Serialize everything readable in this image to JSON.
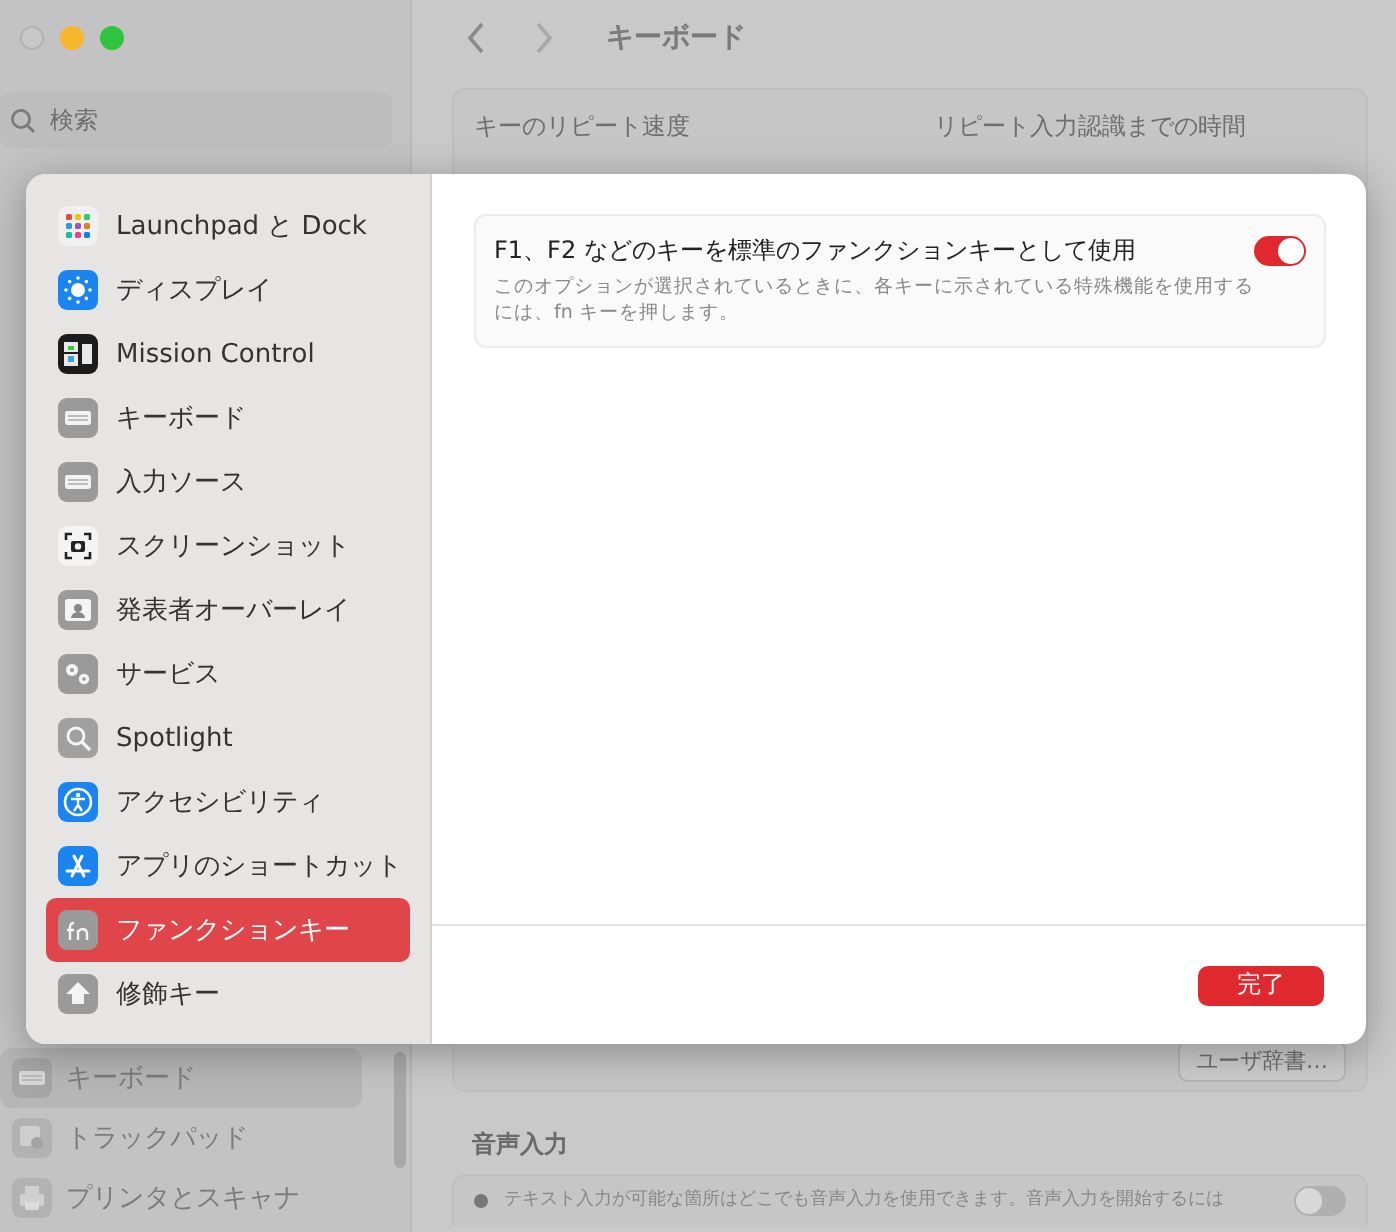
{
  "background_window": {
    "search": {
      "placeholder": "検索"
    },
    "title": "キーボード",
    "section_labels": [
      "キーのリピート速度",
      "リピート入力認識までの時間"
    ],
    "user_dictionary_button": "ユーザ辞書…",
    "sidebar_items": [
      {
        "label": "キーボード",
        "kind": "keyboard",
        "selected": true
      },
      {
        "label": "トラックパッド",
        "kind": "trackpad",
        "selected": false
      },
      {
        "label": "プリンタとスキャナ",
        "kind": "printer",
        "selected": false
      }
    ],
    "dictation": {
      "heading": "音声入力",
      "description": "テキスト入力が可能な箇所はどこでも音声入力を使用できます。音声入力を開始するには",
      "on": false
    }
  },
  "dialog": {
    "sidebar_items": [
      {
        "label": "Launchpad と Dock",
        "kind": "launchpad",
        "selected": false
      },
      {
        "label": "ディスプレイ",
        "kind": "display",
        "selected": false
      },
      {
        "label": "Mission Control",
        "kind": "mission",
        "selected": false
      },
      {
        "label": "キーボード",
        "kind": "keyboard",
        "selected": false
      },
      {
        "label": "入力ソース",
        "kind": "keyboard",
        "selected": false
      },
      {
        "label": "スクリーンショット",
        "kind": "screenshot",
        "selected": false
      },
      {
        "label": "発表者オーバーレイ",
        "kind": "presenter",
        "selected": false
      },
      {
        "label": "サービス",
        "kind": "gears",
        "selected": false
      },
      {
        "label": "Spotlight",
        "kind": "search",
        "selected": false
      },
      {
        "label": "アクセシビリティ",
        "kind": "accessibility",
        "selected": false
      },
      {
        "label": "アプリのショートカット",
        "kind": "appstore",
        "selected": false
      },
      {
        "label": "ファンクションキー",
        "kind": "fn",
        "selected": true
      },
      {
        "label": "修飾キー",
        "kind": "modifier",
        "selected": false
      }
    ],
    "setting": {
      "title": "F1、F2 などのキーを標準のファンクションキーとして使用",
      "description": "このオプションが選択されているときに、各キーに示されている特殊機能を使用するには、fn キーを押します。",
      "on": true
    },
    "done_button": "完了"
  }
}
